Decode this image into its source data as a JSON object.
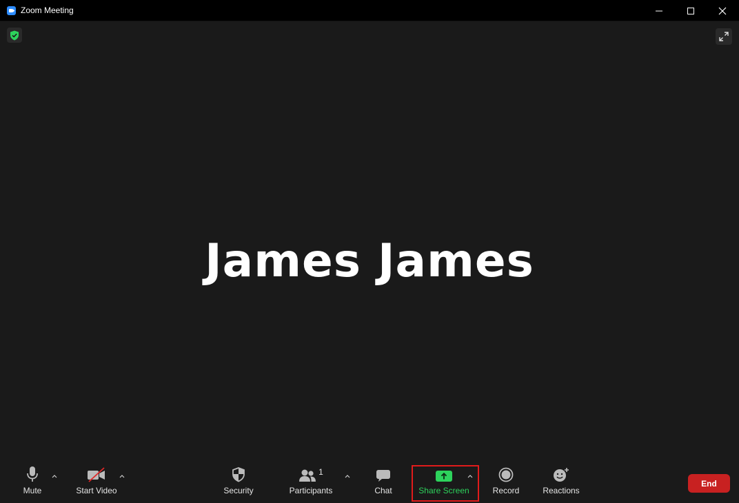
{
  "window": {
    "title": "Zoom Meeting"
  },
  "meeting": {
    "participant_name": "James James"
  },
  "toolbar": {
    "mute_label": "Mute",
    "start_video_label": "Start Video",
    "security_label": "Security",
    "participants_label": "Participants",
    "participants_count": "1",
    "chat_label": "Chat",
    "share_screen_label": "Share Screen",
    "record_label": "Record",
    "reactions_label": "Reactions",
    "end_label": "End"
  },
  "colors": {
    "background": "#1a1a1a",
    "share_accent": "#2dd35c",
    "end_button": "#c82121",
    "highlight_box": "#e21b1b",
    "security_badge": "#2dd35c"
  },
  "icons": {
    "app": "zoom-camera-icon",
    "encryption": "shield-check-icon",
    "fullscreen": "expand-arrows-icon",
    "mute": "microphone-icon",
    "video": "camera-off-icon",
    "security": "shield-icon",
    "participants": "people-icon",
    "chat": "speech-bubble-icon",
    "share": "share-arrow-icon",
    "record": "record-circle-icon",
    "reactions": "smiley-plus-icon"
  }
}
